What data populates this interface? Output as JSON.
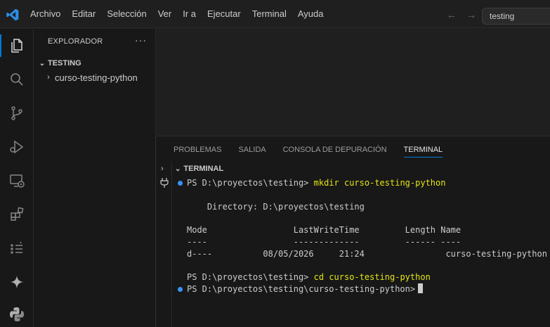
{
  "menu": [
    "Archivo",
    "Editar",
    "Selección",
    "Ver",
    "Ir a",
    "Ejecutar",
    "Terminal",
    "Ayuda"
  ],
  "search": {
    "text": "testing"
  },
  "sidebar": {
    "header": "EXPLORADOR",
    "more": "···",
    "section": "TESTING",
    "folder": "curso-testing-python"
  },
  "panel": {
    "tabs": [
      "PROBLEMAS",
      "SALIDA",
      "CONSOLA DE DEPURACIÓN",
      "TERMINAL"
    ],
    "active_tab": "TERMINAL",
    "terminal_title": "TERMINAL"
  },
  "terminal": {
    "prompt1": "PS D:\\proyectos\\testing> ",
    "cmd1": "mkdir curso-testing-python",
    "blank1": "",
    "directory": "    Directory: D:\\proyectos\\testing",
    "blank2": "",
    "header": "Mode                 LastWriteTime         Length Name",
    "rule": "----                 -------------         ------ ----",
    "row": "d----          08/05/2026     21:24                curso-testing-python",
    "blank3": "",
    "prompt2": "PS D:\\proyectos\\testing> ",
    "cmd2": "cd curso-testing-python",
    "prompt3": "PS D:\\proyectos\\testing\\curso-testing-python>"
  },
  "colors": {
    "accent": "#0078d4",
    "command": "#e5e510",
    "dot": "#3794ff"
  }
}
